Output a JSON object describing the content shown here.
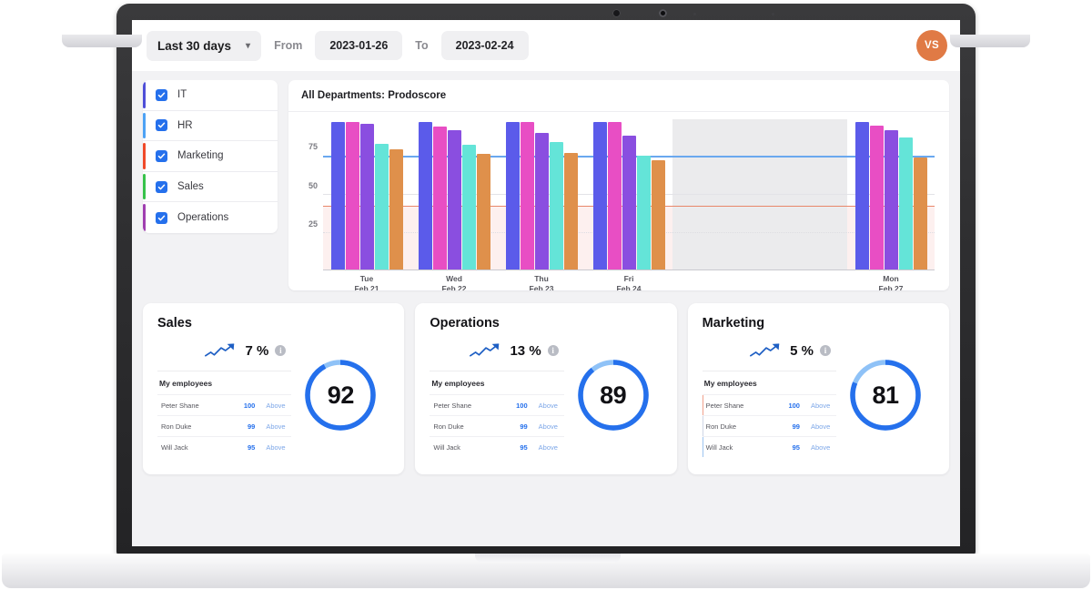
{
  "topbar": {
    "range_label": "Last 30 days",
    "chevron_icon": "chevron-down-icon",
    "from_label": "From",
    "from_value": "2023-01-26",
    "to_label": "To",
    "to_value": "2023-02-24",
    "avatar_initials": "VS",
    "avatar_color": "#e07a45"
  },
  "departments": [
    {
      "label": "IT",
      "color": "#4f4fd8",
      "checked": true
    },
    {
      "label": "HR",
      "color": "#4da2f5",
      "checked": true
    },
    {
      "label": "Marketing",
      "color": "#f04a2a",
      "checked": true
    },
    {
      "label": "Sales",
      "color": "#37c24a",
      "checked": true
    },
    {
      "label": "Operations",
      "color": "#a03fb0",
      "checked": true
    }
  ],
  "chart_data": {
    "type": "bar",
    "title": "All Departments: Prodoscore",
    "xlabel": "",
    "ylabel": "",
    "ylim": [
      0,
      100
    ],
    "yticks": [
      25,
      50,
      75
    ],
    "grid": true,
    "legend": "none",
    "threshold_line": 42,
    "target_line": 75,
    "low_zone": [
      0,
      42
    ],
    "weekend_band": {
      "after_category": "Fri\nFeb 24",
      "span": 2
    },
    "categories": [
      "Tue\nFeb 21",
      "Wed\nFeb 22",
      "Thu\nFeb 23",
      "Fri\nFeb 24",
      "",
      "",
      "Mon\nFeb 27"
    ],
    "series": [
      {
        "name": "IT",
        "color": "#5b5bea",
        "values": [
          98,
          98,
          98,
          98,
          null,
          null,
          98
        ]
      },
      {
        "name": "HR",
        "color": "#e84ec4",
        "values": [
          98,
          95,
          98,
          98,
          null,
          null,
          96
        ]
      },
      {
        "name": "Marketing",
        "color": "#8a4ee0",
        "values": [
          97,
          93,
          91,
          89,
          null,
          null,
          93
        ]
      },
      {
        "name": "Sales",
        "color": "#64e4d8",
        "values": [
          84,
          83,
          85,
          76,
          null,
          null,
          88
        ]
      },
      {
        "name": "Operations",
        "color": "#df904b",
        "values": [
          80,
          77,
          78,
          73,
          null,
          null,
          75
        ]
      }
    ]
  },
  "kpi_cards": [
    {
      "title": "Sales",
      "trend_icon": "trend-up-icon",
      "percent": "7",
      "percent_unit": "%",
      "info_icon": "info-icon",
      "employees_header": "My employees",
      "score": 92,
      "accent": "#2570ec",
      "track": "#8fc2f7",
      "employees": [
        {
          "name": "Peter Shane",
          "score": "100",
          "status": "Above",
          "accent": "transparent"
        },
        {
          "name": "Ron Duke",
          "score": "99",
          "status": "Above",
          "accent": "transparent"
        },
        {
          "name": "Will Jack",
          "score": "95",
          "status": "Above",
          "accent": "transparent"
        }
      ]
    },
    {
      "title": "Operations",
      "trend_icon": "trend-up-icon",
      "percent": "13",
      "percent_unit": "%",
      "info_icon": "info-icon",
      "employees_header": "My employees",
      "score": 89,
      "accent": "#2570ec",
      "track": "#8fc2f7",
      "employees": [
        {
          "name": "Peter Shane",
          "score": "100",
          "status": "Above",
          "accent": "transparent"
        },
        {
          "name": "Ron Duke",
          "score": "99",
          "status": "Above",
          "accent": "transparent"
        },
        {
          "name": "Will Jack",
          "score": "95",
          "status": "Above",
          "accent": "transparent"
        }
      ]
    },
    {
      "title": "Marketing",
      "trend_icon": "trend-up-icon",
      "percent": "5",
      "percent_unit": "%",
      "info_icon": "info-icon",
      "employees_header": "My employees",
      "score": 81,
      "accent": "#2570ec",
      "track": "#8fc2f7",
      "employees": [
        {
          "name": "Peter Shane",
          "score": "100",
          "status": "Above",
          "accent": "#f0a18c"
        },
        {
          "name": "Ron Duke",
          "score": "99",
          "status": "Above",
          "accent": "#cfd6e6"
        },
        {
          "name": "Will Jack",
          "score": "95",
          "status": "Above",
          "accent": "#9ec4f0"
        }
      ]
    }
  ]
}
